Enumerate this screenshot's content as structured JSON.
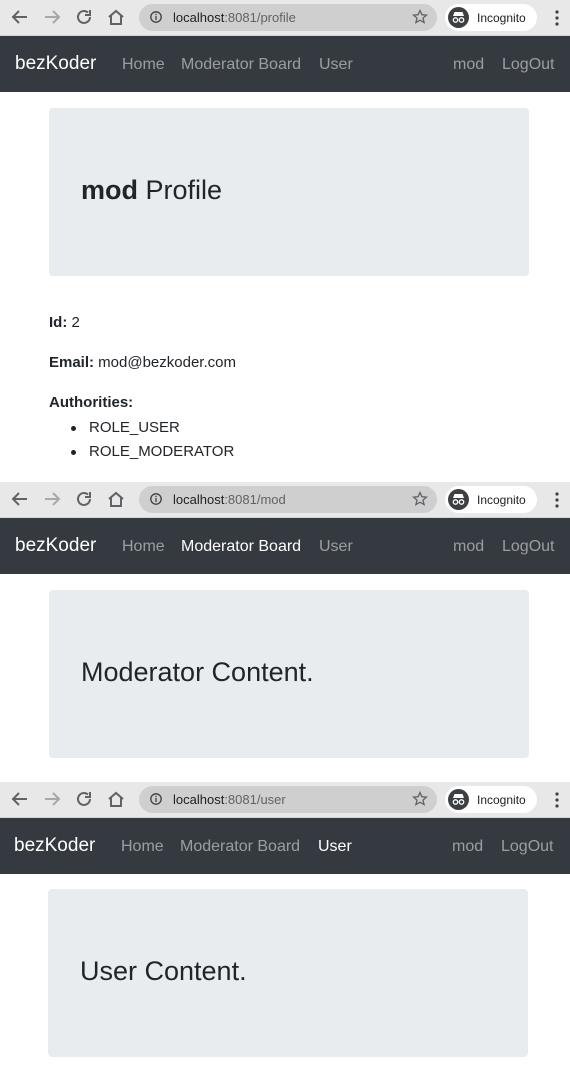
{
  "colors": {
    "navbar_bg": "#343a40",
    "jumbotron_bg": "#e9ecef",
    "nav_link_muted": "rgba(255,255,255,0.5)",
    "nav_link_active": "#ffffff"
  },
  "screens": [
    {
      "browser": {
        "url_host": "localhost",
        "url_path": ":8081/profile",
        "incognito_label": "Incognito"
      },
      "navbar": {
        "brand": "bezKoder",
        "left_links": [
          "Home",
          "Moderator Board",
          "User"
        ],
        "right_links": [
          "mod",
          "LogOut"
        ],
        "active": "none"
      },
      "jumbotron": {
        "heading_bold": "mod",
        "heading_rest": " Profile"
      },
      "profile": {
        "id_label": "Id:",
        "id_value": " 2",
        "email_label": "Email:",
        "email_value": " mod@bezkoder.com",
        "authorities_label": "Authorities:",
        "authorities": [
          "ROLE_USER",
          "ROLE_MODERATOR"
        ]
      }
    },
    {
      "browser": {
        "url_host": "localhost",
        "url_path": ":8081/mod",
        "incognito_label": "Incognito"
      },
      "navbar": {
        "brand": "bezKoder",
        "left_links": [
          "Home",
          "Moderator Board",
          "User"
        ],
        "right_links": [
          "mod",
          "LogOut"
        ],
        "active": "Moderator Board"
      },
      "jumbotron": {
        "heading": "Moderator Content."
      }
    },
    {
      "browser": {
        "url_host": "localhost",
        "url_path": ":8081/user",
        "incognito_label": "Incognito"
      },
      "navbar": {
        "brand": "bezKoder",
        "left_links": [
          "Home",
          "Moderator Board",
          "User"
        ],
        "right_links": [
          "mod",
          "LogOut"
        ],
        "active": "User"
      },
      "jumbotron": {
        "heading": "User Content."
      }
    }
  ]
}
